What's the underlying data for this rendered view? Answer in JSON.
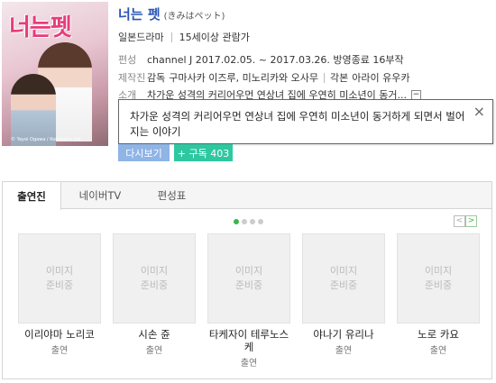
{
  "poster": {
    "title_art": "너는펫",
    "small_text": "© Yayoi Ogawa / Kodansha Ltd."
  },
  "show": {
    "title": "너는 펫",
    "original_title": "(きみはペット)",
    "genre": "일본드라마",
    "rating": "15세이상 관람가"
  },
  "details": {
    "broadcast_label": "편성",
    "broadcast_value": "channel J 2017.02.05. ~ 2017.03.26. 방영종료 16부작",
    "production_label": "제작진",
    "director_role": "감독",
    "directors": "구마사카 이즈루, 미노리카와 오사무",
    "writer_role": "각본",
    "writer": "아라이 유우카",
    "intro_label": "소개",
    "intro_short": "차가운 성격의 커리어우먼 연상녀 집에 우연히 미소년이 동거...",
    "more_symbol": "−"
  },
  "tooltip": {
    "text": "차가운 성격의 커리어우먼 연상녀 집에 우연히 미소년이 동거하게 되면서 벌어지는 이야기",
    "close_symbol": "×"
  },
  "buttons": {
    "replay": "다시보기",
    "subscribe": "+ 구독 403"
  },
  "tabs": [
    {
      "label": "출연진"
    },
    {
      "label": "네이버TV"
    },
    {
      "label": "편성표"
    }
  ],
  "carousel": {
    "prev": "<",
    "next": ">",
    "page_count": 4,
    "current_page": 1
  },
  "cast": [
    {
      "placeholder": "이미지\n준비중",
      "name": "이리야마 노리코",
      "role": "출연"
    },
    {
      "placeholder": "이미지\n준비중",
      "name": "시손 쥰",
      "role": "출연"
    },
    {
      "placeholder": "이미지\n준비중",
      "name": "타케자이 테루노스케",
      "role": "출연"
    },
    {
      "placeholder": "이미지\n준비중",
      "name": "야나기 유리나",
      "role": "출연"
    },
    {
      "placeholder": "이미지\n준비중",
      "name": "노로 카요",
      "role": "출연"
    }
  ],
  "colors": {
    "title": "#2a55b8",
    "replay": "#8fb4e6",
    "subscribe": "#2ec8a0",
    "active_dot": "#3bb54a"
  }
}
